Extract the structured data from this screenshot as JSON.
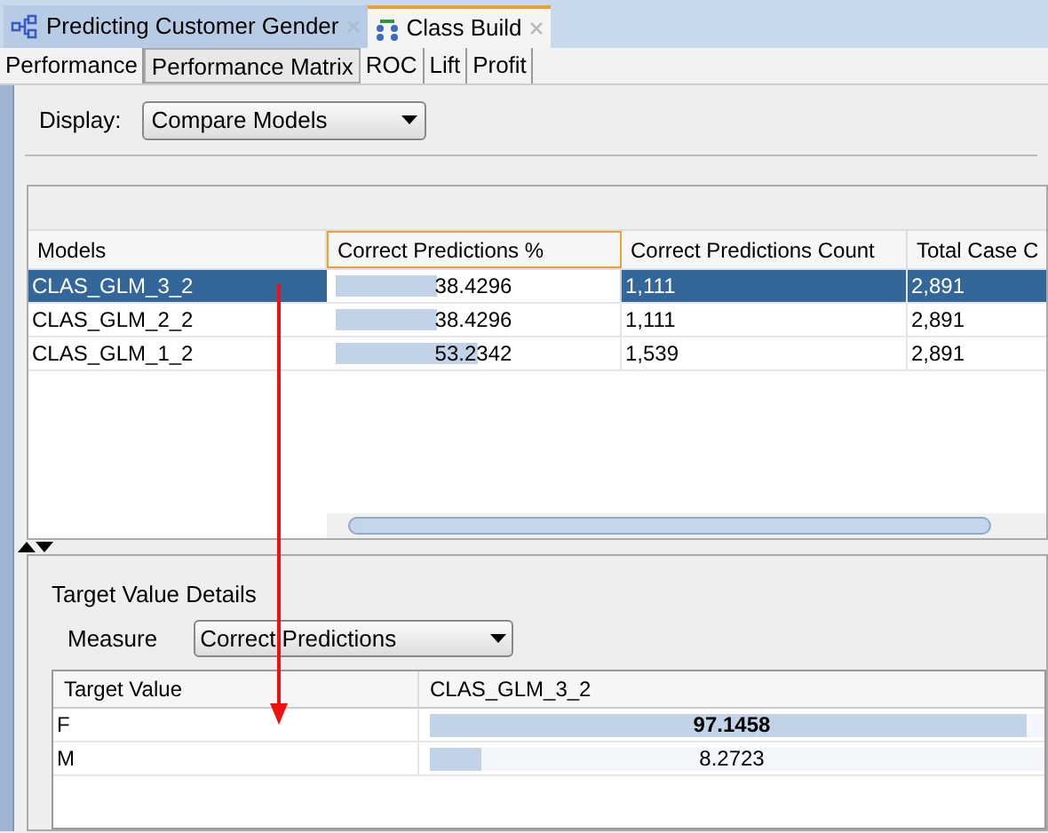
{
  "editor_tabs": [
    {
      "label": "Predicting Customer Gender",
      "selected": false
    },
    {
      "label": "Class Build",
      "selected": true
    }
  ],
  "sub_tabs": [
    {
      "label": "Performance",
      "selected": false
    },
    {
      "label": "Performance Matrix",
      "selected": true
    },
    {
      "label": "ROC",
      "selected": false
    },
    {
      "label": "Lift",
      "selected": false
    },
    {
      "label": "Profit",
      "selected": false
    }
  ],
  "display": {
    "label": "Display:",
    "value": "Compare Models"
  },
  "models_table": {
    "columns": [
      {
        "label": "Models",
        "selected": false
      },
      {
        "label": "Correct Predictions %",
        "selected": true
      },
      {
        "label": "Correct Predictions Count",
        "selected": false
      },
      {
        "label": "Total Case C",
        "selected": false
      }
    ],
    "rows": [
      {
        "model": "CLAS_GLM_3_2",
        "percent": "38.4296",
        "level": 0.38,
        "count": "1,111",
        "total": "2,891",
        "selected": true
      },
      {
        "model": "CLAS_GLM_2_2",
        "percent": "38.4296",
        "level": 0.38,
        "count": "1,111",
        "total": "2,891",
        "selected": false
      },
      {
        "model": "CLAS_GLM_1_2",
        "percent": "53.2342",
        "level": 0.53,
        "count": "1,539",
        "total": "2,891",
        "selected": false
      }
    ]
  },
  "details": {
    "title": "Target Value Details",
    "measure_label": "Measure",
    "measure_value": "Correct Predictions",
    "columns": [
      "Target Value",
      "CLAS_GLM_3_2"
    ],
    "rows": [
      {
        "target": "F",
        "value": "97.1458",
        "level": 0.97,
        "bold": true
      },
      {
        "target": "M",
        "value": "8.2723",
        "level": 0.083,
        "bold": false
      }
    ]
  }
}
